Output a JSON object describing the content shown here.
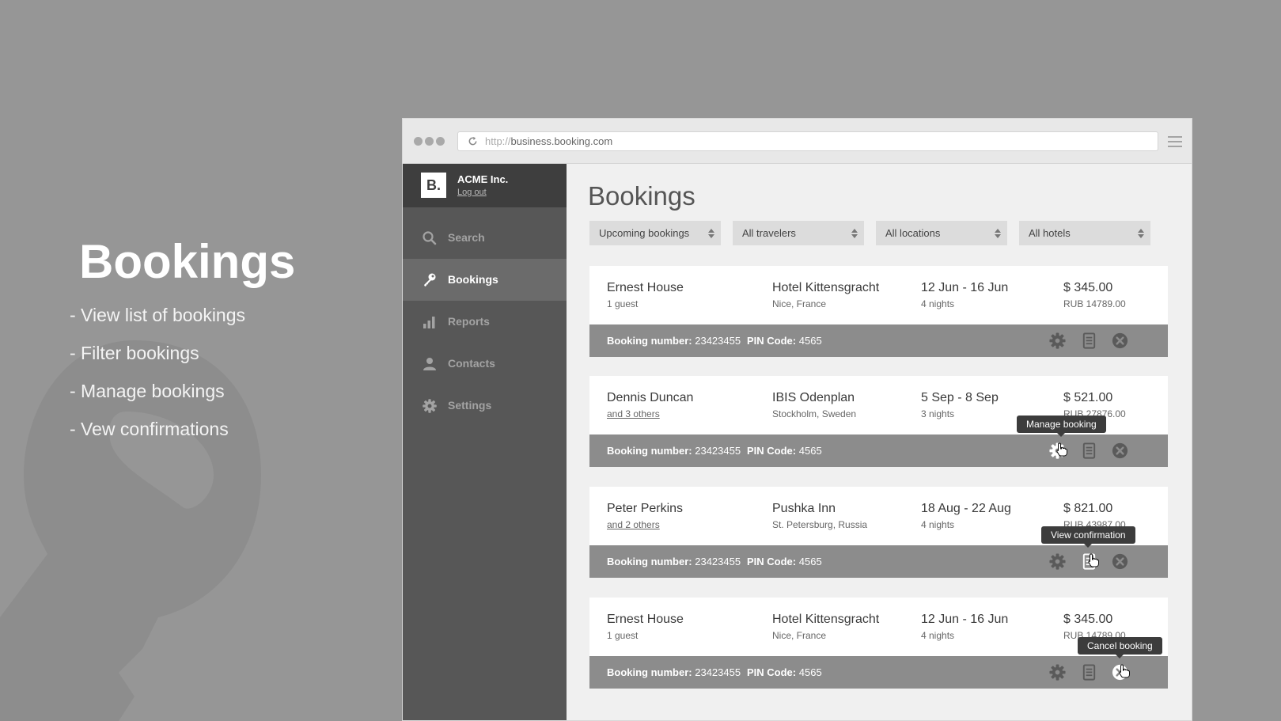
{
  "slide": {
    "title": "Bookings",
    "points": [
      "- View list of bookings",
      "- Filter bookings",
      "- Manage bookings",
      "- Vew confirmations"
    ]
  },
  "browser": {
    "url_prefix": "http://",
    "url_host": "business.booking.com"
  },
  "account": {
    "logo": "B.",
    "name": "ACME Inc.",
    "logout": "Log out"
  },
  "nav": [
    {
      "label": "Search",
      "icon": "search-icon",
      "active": false
    },
    {
      "label": "Bookings",
      "icon": "key-icon",
      "active": true
    },
    {
      "label": "Reports",
      "icon": "bar-chart-icon",
      "active": false
    },
    {
      "label": "Contacts",
      "icon": "person-icon",
      "active": false
    },
    {
      "label": "Settings",
      "icon": "gear-icon",
      "active": false
    }
  ],
  "page": {
    "title": "Bookings"
  },
  "filters": [
    "Upcoming bookings",
    "All travelers",
    "All locations",
    "All hotels"
  ],
  "labels": {
    "booking_number": "Booking number:",
    "pin_code": "PIN Code:"
  },
  "bookings": [
    {
      "guest": "Ernest House",
      "guest_sub": "1 guest",
      "hotel": "Hotel Kittensgracht",
      "location": "Nice, France",
      "dates": "12 Jun - 16 Jun",
      "nights": "4 nights",
      "price": "$ 345.00",
      "price_rub": "RUB 14789.00",
      "booking_number": "23423455",
      "pin": "4565"
    },
    {
      "guest": "Dennis Duncan",
      "guest_sub": "and 3 others",
      "hotel": "IBIS Odenplan",
      "location": "Stockholm, Sweden",
      "dates": "5 Sep - 8 Sep",
      "nights": "3 nights",
      "price": "$ 521.00",
      "price_rub": "RUB 27876.00",
      "booking_number": "23423455",
      "pin": "4565"
    },
    {
      "guest": "Peter Perkins",
      "guest_sub": "and 2 others",
      "hotel": "Pushka Inn",
      "location": "St. Petersburg, Russia",
      "dates": "18 Aug - 22 Aug",
      "nights": "4 nights",
      "price": "$ 821.00",
      "price_rub": "RUB 43987.00",
      "booking_number": "23423455",
      "pin": "4565"
    },
    {
      "guest": "Ernest House",
      "guest_sub": "1 guest",
      "hotel": "Hotel Kittensgracht",
      "location": "Nice, France",
      "dates": "12 Jun - 16 Jun",
      "nights": "4 nights",
      "price": "$ 345.00",
      "price_rub": "RUB 14789.00",
      "booking_number": "23423455",
      "pin": "4565"
    }
  ],
  "tooltips": {
    "manage": "Manage booking",
    "confirmation": "View confirmation",
    "cancel": "Cancel booking"
  },
  "icons": {
    "manage": "gear-icon",
    "confirmation": "document-icon",
    "cancel": "close-circle-icon",
    "cursor": "hand-cursor-icon"
  }
}
